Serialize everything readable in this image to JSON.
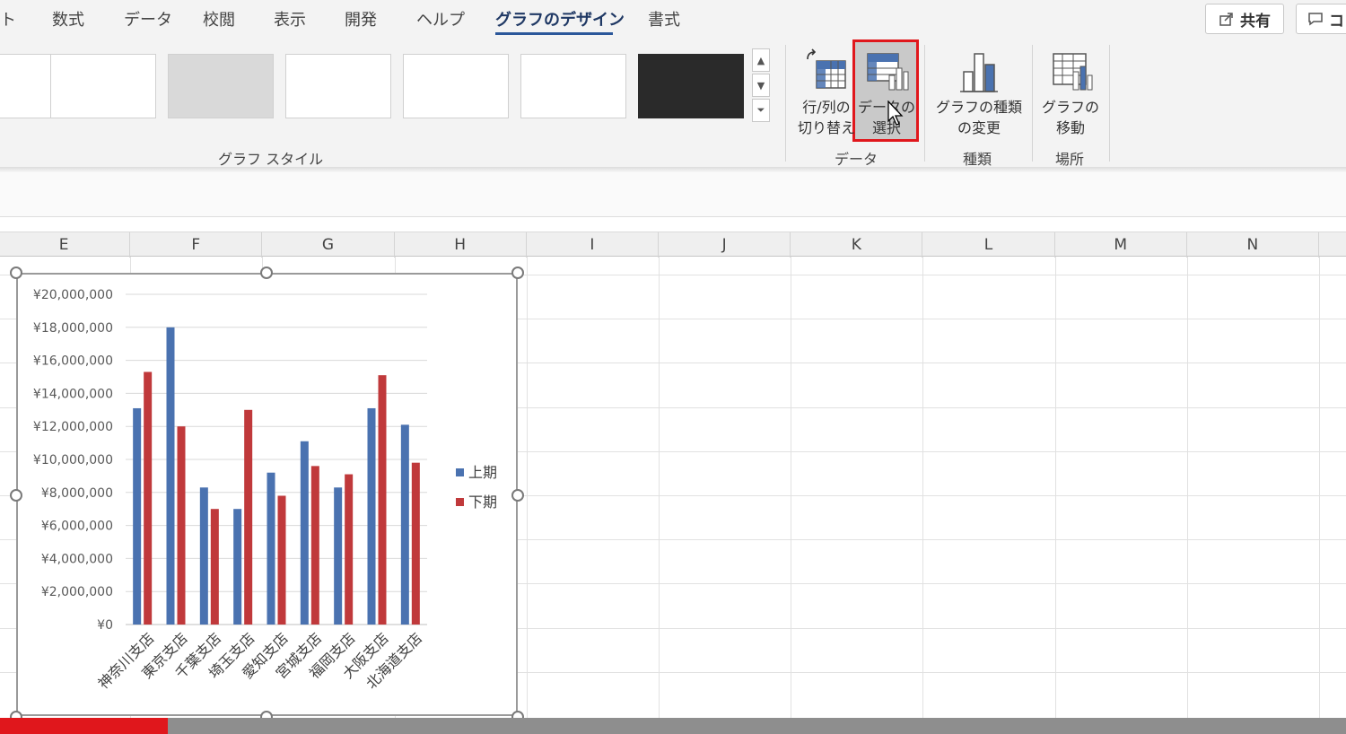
{
  "ribbon": {
    "tabs": [
      {
        "label": "ト"
      },
      {
        "label": "数式"
      },
      {
        "label": "データ"
      },
      {
        "label": "校閲"
      },
      {
        "label": "表示"
      },
      {
        "label": "開発"
      },
      {
        "label": "ヘルプ"
      },
      {
        "label": "グラフのデザイン",
        "active": true
      },
      {
        "label": "書式"
      }
    ],
    "share_label": "共有",
    "comment_label": "コ",
    "groups": {
      "styles_label": "グラフ スタイル",
      "data_label": "データ",
      "type_label": "種類",
      "location_label": "場所"
    },
    "buttons": {
      "switch_row_col": "行/列の\n切り替え",
      "select_data": "データの\n選択",
      "change_chart_type": "グラフの種類\nの変更",
      "move_chart": "グラフの\n移動"
    },
    "highlight_color": "#e0171c"
  },
  "columns": [
    "E",
    "F",
    "G",
    "H",
    "I",
    "J",
    "K",
    "L",
    "M",
    "N"
  ],
  "chart_data": {
    "type": "bar",
    "categories": [
      "神奈川支店",
      "東京支店",
      "千葉支店",
      "埼玉支店",
      "愛知支店",
      "宮城支店",
      "福岡支店",
      "大阪支店",
      "北海道支店"
    ],
    "series": [
      {
        "name": "上期",
        "color": "#4a72b0",
        "values": [
          13100000,
          18000000,
          8300000,
          7000000,
          9200000,
          11100000,
          8300000,
          13100000,
          12100000
        ]
      },
      {
        "name": "下期",
        "color": "#c0393b",
        "values": [
          15300000,
          12000000,
          7000000,
          13000000,
          7800000,
          9600000,
          9100000,
          15100000,
          9800000
        ]
      }
    ],
    "yticks": [
      "¥0",
      "¥2,000,000",
      "¥4,000,000",
      "¥6,000,000",
      "¥8,000,000",
      "¥10,000,000",
      "¥12,000,000",
      "¥14,000,000",
      "¥16,000,000",
      "¥18,000,000",
      "¥20,000,000"
    ],
    "ylim": [
      0,
      20000000
    ],
    "legend_position": "right",
    "grid": true
  }
}
